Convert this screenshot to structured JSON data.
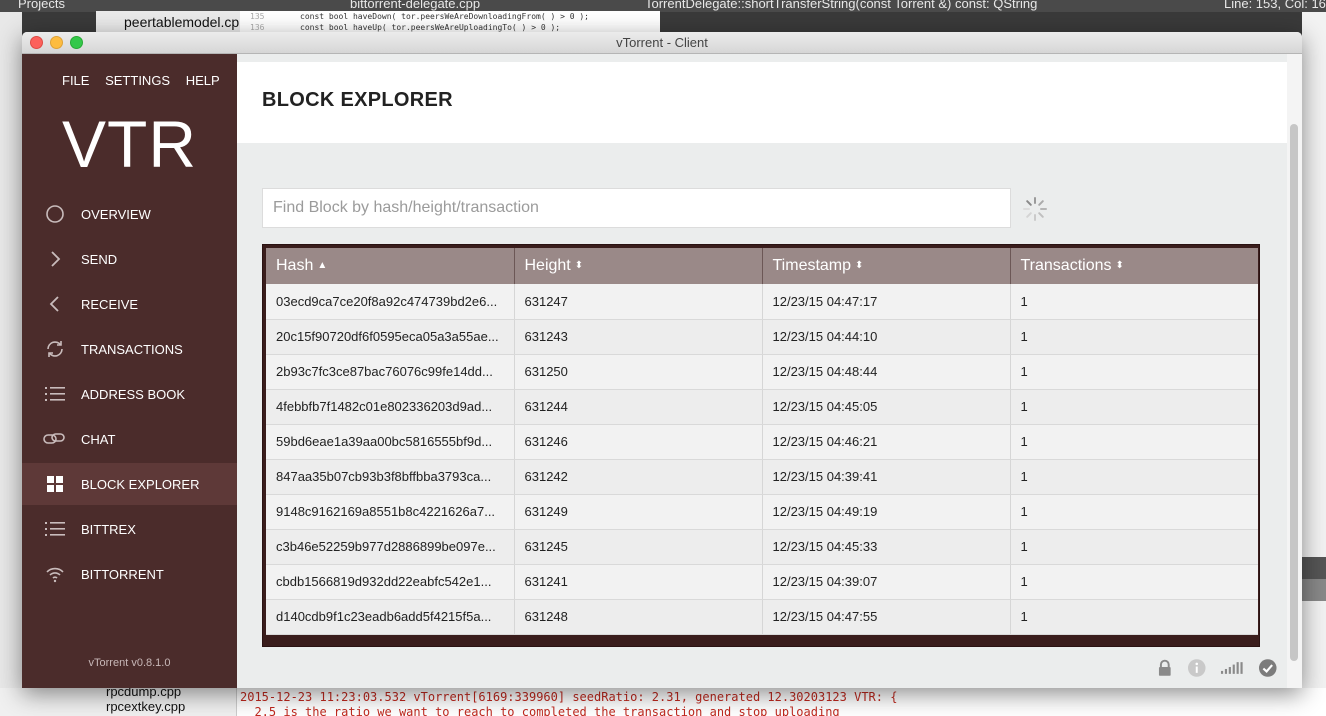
{
  "ide": {
    "projects_label": "Projects",
    "tab_cpp": "bittorrent-delegate.cpp",
    "tab_func": "TorrentDelegate::shortTransferString(const Torrent &) const: QString",
    "position": "Line: 153, Col: 16",
    "file_top": "peertablemodel.cpp",
    "code_ln1": "135",
    "code_line1": "const bool haveDown( tor.peersWeAreDownloadingFrom( ) > 0 );",
    "code_ln2": "136",
    "code_line2": "const bool haveUp( tor.peersWeAreUploadingTo( ) > 0 );",
    "file_bottom1": "rpcdump.cpp",
    "file_bottom2": "rpcextkey.cpp",
    "console_line1": "2015-12-23 11:23:03.532 vTorrent[6169:339960] seedRatio: 2.31, generated 12.30203123 VTR: {",
    "console_line2": "  2.5 is the ratio we want to reach to completed the transaction and stop uploading"
  },
  "window": {
    "title": "vTorrent - Client"
  },
  "menu": {
    "file": "FILE",
    "settings": "SETTINGS",
    "help": "HELP"
  },
  "logo": "VTR",
  "nav": [
    {
      "label": "OVERVIEW",
      "icon": "circle-icon"
    },
    {
      "label": "SEND",
      "icon": "chevron-right-icon"
    },
    {
      "label": "RECEIVE",
      "icon": "chevron-left-icon"
    },
    {
      "label": "TRANSACTIONS",
      "icon": "refresh-icon"
    },
    {
      "label": "ADDRESS BOOK",
      "icon": "list-icon"
    },
    {
      "label": "CHAT",
      "icon": "chat-link-icon"
    },
    {
      "label": "BLOCK EXPLORER",
      "icon": "grid-icon"
    },
    {
      "label": "BITTREX",
      "icon": "list-icon"
    },
    {
      "label": "BITTORRENT",
      "icon": "wifi-icon"
    }
  ],
  "version": "vTorrent v0.8.1.0",
  "page": {
    "title": "BLOCK EXPLORER"
  },
  "search": {
    "placeholder": "Find Block by hash/height/transaction",
    "value": ""
  },
  "table": {
    "columns": [
      "Hash",
      "Height",
      "Timestamp",
      "Transactions"
    ],
    "rows": [
      [
        "03ecd9ca7ce20f8a92c474739bd2e6...",
        "631247",
        "12/23/15 04:47:17",
        "1"
      ],
      [
        "20c15f90720df6f0595eca05a3a55ae...",
        "631243",
        "12/23/15 04:44:10",
        "1"
      ],
      [
        "2b93c7fc3ce87bac76076c99fe14dd...",
        "631250",
        "12/23/15 04:48:44",
        "1"
      ],
      [
        "4febbfb7f1482c01e802336203d9ad...",
        "631244",
        "12/23/15 04:45:05",
        "1"
      ],
      [
        "59bd6eae1a39aa00bc5816555bf9d...",
        "631246",
        "12/23/15 04:46:21",
        "1"
      ],
      [
        "847aa35b07cb93b3f8bffbba3793ca...",
        "631242",
        "12/23/15 04:39:41",
        "1"
      ],
      [
        "9148c9162169a8551b8c4221626a7...",
        "631249",
        "12/23/15 04:49:19",
        "1"
      ],
      [
        "c3b46e52259b977d2886899be097e...",
        "631245",
        "12/23/15 04:45:33",
        "1"
      ],
      [
        "cbdb1566819d932dd22eabfc542e1...",
        "631241",
        "12/23/15 04:39:07",
        "1"
      ],
      [
        "d140cdb9f1c23eadb6add5f4215f5a...",
        "631248",
        "12/23/15 04:47:55",
        "1"
      ]
    ]
  },
  "status": {
    "icons": [
      "lock-icon",
      "info-icon",
      "signal-icon",
      "check-circle-icon"
    ]
  }
}
